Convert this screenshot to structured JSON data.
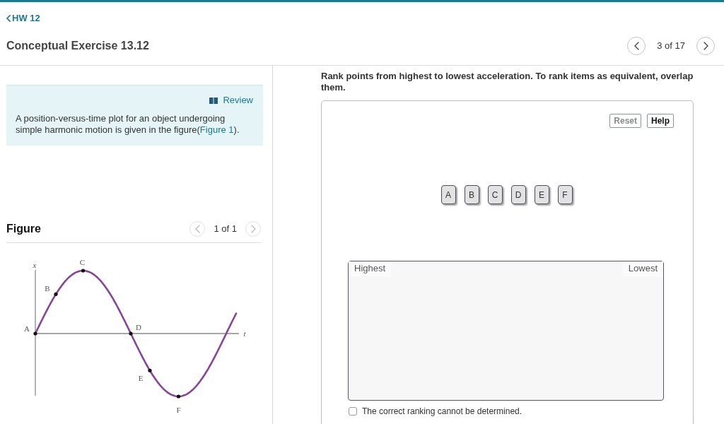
{
  "header": {
    "back_link": "HW 12",
    "title": "Conceptual Exercise 13.12",
    "pager": {
      "position": "3 of 17",
      "prev": {
        "disabled": false
      },
      "next": {
        "disabled": false
      }
    }
  },
  "review": {
    "link": "Review",
    "text_before": "A position-versus-time plot for an object undergoing simple harmonic motion is given in the figure(",
    "figure_link": "Figure 1",
    "text_after": ")."
  },
  "figure": {
    "heading": "Figure",
    "pager": {
      "position": "1 of 1",
      "prev": {
        "disabled": true
      },
      "next": {
        "disabled": true
      }
    },
    "axes": {
      "vertical": "x",
      "horizontal": "t"
    },
    "points": [
      {
        "label": "A"
      },
      {
        "label": "B"
      },
      {
        "label": "C"
      },
      {
        "label": "D"
      },
      {
        "label": "E"
      },
      {
        "label": "F"
      }
    ]
  },
  "question": {
    "prompt": "Rank points from highest to lowest acceleration. To rank items as equivalent, overlap them.",
    "buttons": [
      {
        "label": "Reset",
        "disabled": true
      },
      {
        "label": "Help",
        "disabled": false
      }
    ],
    "items": [
      {
        "label": "A"
      },
      {
        "label": "B"
      },
      {
        "label": "C"
      },
      {
        "label": "D"
      },
      {
        "label": "E"
      },
      {
        "label": "F"
      }
    ],
    "ranking_area": {
      "start_label": "Highest",
      "end_label": "Lowest"
    },
    "cannot_determine": {
      "label": "The correct ranking cannot be determined.",
      "checked": false
    }
  }
}
